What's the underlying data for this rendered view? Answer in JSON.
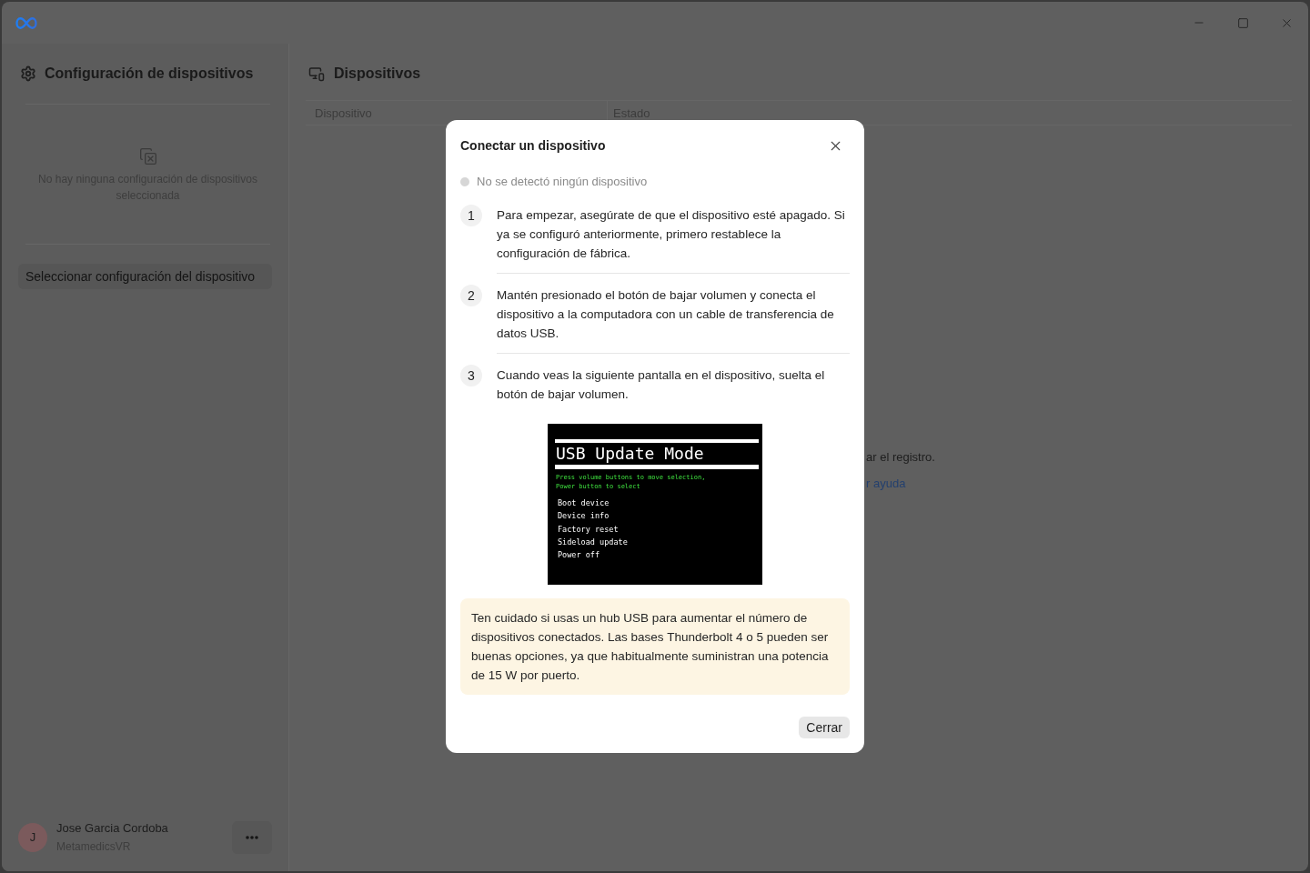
{
  "sidebar": {
    "title": "Configuración de dispositivos",
    "empty_state": "No hay ninguna configuración de dispositivos seleccionada",
    "select_button": "Seleccionar configuración del dispositivo",
    "user": {
      "initial": "J",
      "name": "Jose Garcia Cordoba",
      "organization": "MetamedicsVR"
    }
  },
  "main": {
    "title": "Dispositivos",
    "table": {
      "columns": [
        "Dispositivo",
        "Estado"
      ]
    },
    "partial_message": "ar el registro.",
    "partial_link": "r ayuda"
  },
  "dialog": {
    "title": "Conectar un dispositivo",
    "status": {
      "text": "No se detectó ningún dispositivo",
      "detected": false
    },
    "steps": [
      {
        "number": "1",
        "text": "Para empezar, asegúrate de que el dispositivo esté apagado. Si ya se configuró anteriormente, primero restablece la configuración de fábrica."
      },
      {
        "number": "2",
        "text": "Mantén presionado el botón de bajar volumen y conecta el dispositivo a la computadora con un cable de transferencia de datos USB."
      },
      {
        "number": "3",
        "text": "Cuando veas la siguiente pantalla en el dispositivo, suelta el botón de bajar volumen."
      }
    ],
    "device_screen": {
      "title": "USB Update Mode",
      "hint_lines": [
        "Press volume buttons to move selection,",
        "Power button to select"
      ],
      "menu": [
        "Boot device",
        "Device info",
        "Factory reset",
        "Sideload update",
        "Power off"
      ]
    },
    "warning": "Ten cuidado si usas un hub USB para aumentar el número de dispositivos conectados. Las bases Thunderbolt 4 o 5 pueden ser buenas opciones, ya que habitualmente suministran una potencia de 15 W por puerto.",
    "close_button": "Cerrar"
  }
}
